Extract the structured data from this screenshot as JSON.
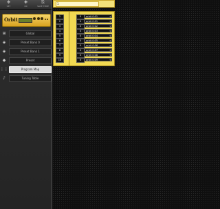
{
  "toolbar": {
    "buttons": [
      {
        "label": "SET",
        "icon": "gear-icon",
        "glyph": "✥"
      },
      {
        "label": "INI",
        "icon": "add-icon",
        "glyph": "✚"
      },
      {
        "label": "SAVE TEMP",
        "icon": "save-icon",
        "glyph": "⎘"
      }
    ]
  },
  "logo": {
    "name": "Orbit"
  },
  "sidebar": {
    "items": [
      {
        "label": "Global",
        "icon": "global-icon",
        "glyph": "⊞"
      },
      {
        "label": "Preset Bank 0",
        "icon": "bank-icon",
        "glyph": "◈"
      },
      {
        "label": "Preset Bank 1",
        "icon": "bank-icon",
        "glyph": "◈"
      },
      {
        "label": "Preset",
        "icon": "preset-icon",
        "glyph": "◆"
      },
      {
        "label": "Program Map",
        "icon": "map-icon",
        "glyph": "⋮⋮"
      },
      {
        "label": "Tuning Table",
        "icon": "tuning-icon",
        "glyph": "♪"
      }
    ],
    "active_index": 4
  },
  "title": {
    "value": "1"
  },
  "program_map": {
    "rows": [
      {
        "program": "1",
        "bank": "0",
        "preset": "orbit 0:01"
      },
      {
        "program": "2",
        "bank": "0",
        "preset": "orbit 0:01"
      },
      {
        "program": "3",
        "bank": "0",
        "preset": "orbit 0:02"
      },
      {
        "program": "4",
        "bank": "0",
        "preset": "orbit 0:03"
      },
      {
        "program": "5",
        "bank": "0",
        "preset": "orbit 0:04"
      },
      {
        "program": "6",
        "bank": "0",
        "preset": "orbit 0:05"
      },
      {
        "program": "7",
        "bank": "0",
        "preset": "orbit 0:06"
      },
      {
        "program": "8",
        "bank": "0",
        "preset": "orbit 0:07"
      },
      {
        "program": "9",
        "bank": "0",
        "preset": "orbit 0:08"
      },
      {
        "program": "10",
        "bank": "0",
        "preset": "orbit 0:09"
      }
    ]
  },
  "colors": {
    "accent": "#f2da52",
    "background": "#151515"
  }
}
